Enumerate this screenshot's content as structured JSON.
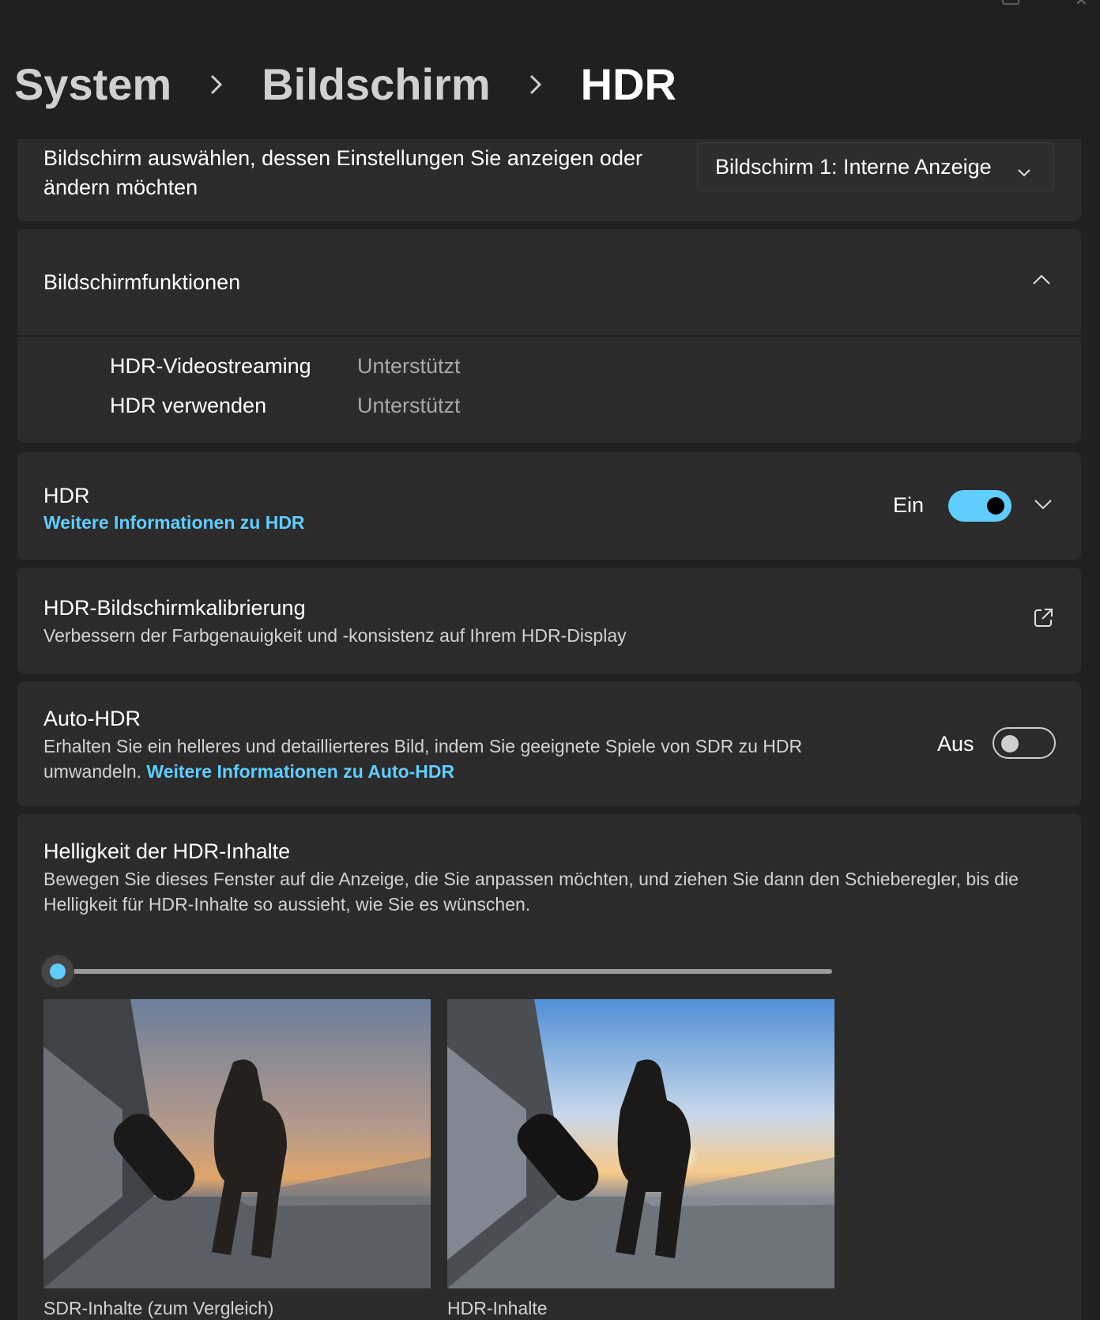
{
  "breadcrumb": {
    "items": [
      "System",
      "Bildschirm"
    ],
    "current": "HDR"
  },
  "display_select": {
    "label": "Bildschirm auswählen, dessen Einstellungen Sie anzeigen oder ändern möchten",
    "value": "Bildschirm 1: Interne Anzeige"
  },
  "features": {
    "title": "Bildschirmfunktionen",
    "rows": [
      {
        "name": "HDR-Videostreaming",
        "value": "Unterstützt"
      },
      {
        "name": "HDR verwenden",
        "value": "Unterstützt"
      }
    ]
  },
  "hdr": {
    "title": "HDR",
    "link": "Weitere Informationen zu HDR",
    "state": "Ein",
    "enabled": true
  },
  "calibration": {
    "title": "HDR-Bildschirmkalibrierung",
    "description": "Verbessern der Farbgenauigkeit und -konsistenz auf Ihrem HDR-Display"
  },
  "auto_hdr": {
    "title": "Auto-HDR",
    "description": "Erhalten Sie ein helleres und detaillierteres Bild, indem Sie geeignete Spiele von SDR zu HDR umwandeln.",
    "link": "Weitere Informationen zu Auto-HDR",
    "state": "Aus",
    "enabled": false
  },
  "brightness": {
    "title": "Helligkeit der HDR-Inhalte",
    "description": "Bewegen Sie dieses Fenster auf die Anzeige, die Sie anpassen möchten, und ziehen Sie dann den Schieberegler, bis die Helligkeit für HDR-Inhalte so aussieht, wie Sie es wünschen.",
    "slider_value": 0,
    "sdr_caption": "SDR-Inhalte (zum Vergleich)",
    "hdr_caption": "HDR-Inhalte"
  },
  "colors": {
    "accent": "#60cdff",
    "background": "#202020",
    "card": "#2b2b2b"
  }
}
